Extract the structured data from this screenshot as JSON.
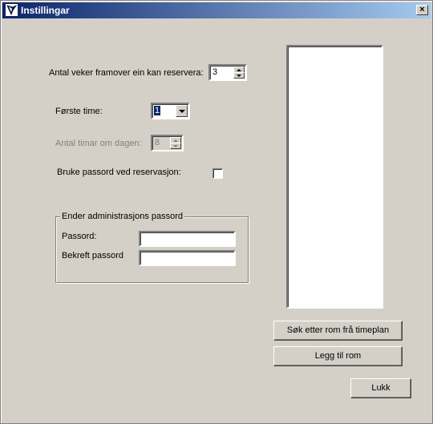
{
  "window": {
    "title": "Instillingar",
    "close_label": "×"
  },
  "weeks": {
    "label": "Antal veker  framover ein kan reservera:",
    "value": "3"
  },
  "first_hour": {
    "label": "Første time:",
    "value": "1"
  },
  "hours_per_day": {
    "label": "Antal timar om dagen:",
    "value": "8"
  },
  "use_password": {
    "label": "Bruke passord ved reservasjon:",
    "checked": false
  },
  "admin_password": {
    "group_title": "Ender administrasjons passord",
    "password_label": "Passord:",
    "password_value": "",
    "confirm_label": "Bekreft passord",
    "confirm_value": ""
  },
  "rooms": {
    "items": []
  },
  "buttons": {
    "search_rooms": "Søk etter rom frå timeplan",
    "add_room": "Legg til rom",
    "close": "Lukk"
  }
}
